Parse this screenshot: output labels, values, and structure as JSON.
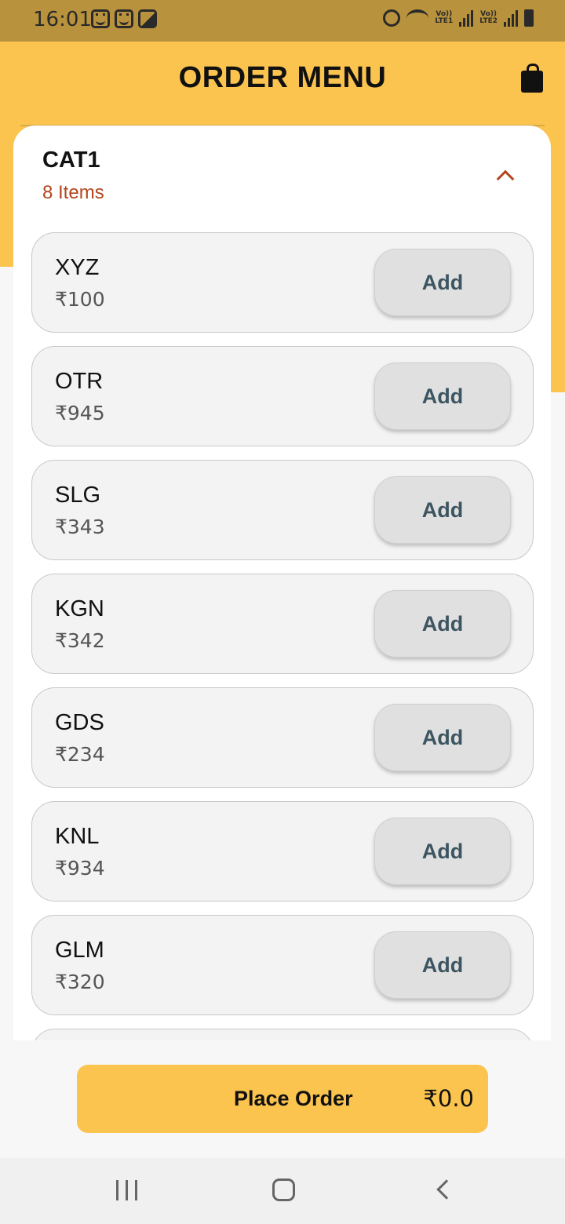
{
  "status_bar": {
    "time": "16:01"
  },
  "header": {
    "title": "ORDER MENU"
  },
  "category": {
    "name": "CAT1",
    "count_label": "8 Items",
    "items": [
      {
        "name": "XYZ",
        "price": "₹100",
        "button": "Add"
      },
      {
        "name": "OTR",
        "price": "₹945",
        "button": "Add"
      },
      {
        "name": "SLG",
        "price": "₹343",
        "button": "Add"
      },
      {
        "name": "KGN",
        "price": "₹342",
        "button": "Add"
      },
      {
        "name": "GDS",
        "price": "₹234",
        "button": "Add"
      },
      {
        "name": "KNL",
        "price": "₹934",
        "button": "Add"
      },
      {
        "name": "GLM",
        "price": "₹320",
        "button": "Add"
      }
    ]
  },
  "order_button": {
    "label": "Place Order",
    "total": "₹0.0"
  },
  "colors": {
    "accent": "#fbc44e",
    "count_text": "#b3461e",
    "add_text": "#3d5561"
  }
}
